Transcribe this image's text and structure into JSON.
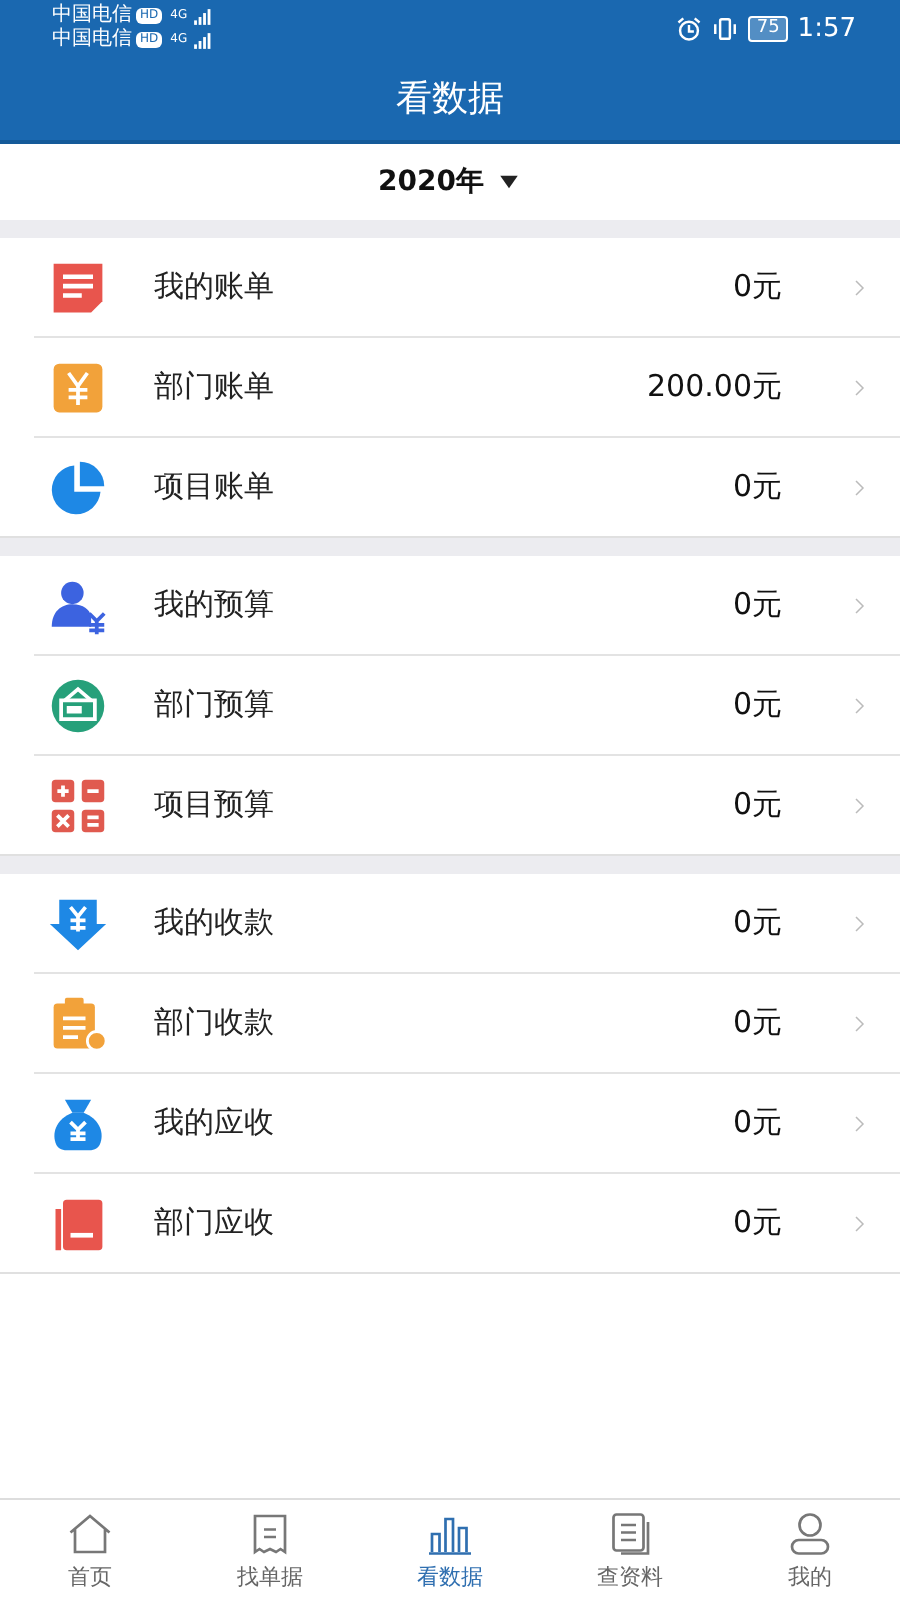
{
  "status_bar": {
    "carriers": [
      {
        "name": "中国电信",
        "badge": "HD",
        "network": "4G"
      },
      {
        "name": "中国电信",
        "badge": "HD",
        "network": "4G"
      }
    ],
    "battery": "75",
    "time": "1:57"
  },
  "title": "看数据",
  "year_picker": {
    "label": "2020年"
  },
  "groups": [
    {
      "items": [
        {
          "kind": "my-bill",
          "label": "我的账单",
          "amount": "0元"
        },
        {
          "kind": "dept-bill",
          "label": "部门账单",
          "amount": "200.00元"
        },
        {
          "kind": "project-bill",
          "label": "项目账单",
          "amount": "0元"
        }
      ]
    },
    {
      "items": [
        {
          "kind": "my-budget",
          "label": "我的预算",
          "amount": "0元"
        },
        {
          "kind": "dept-budget",
          "label": "部门预算",
          "amount": "0元"
        },
        {
          "kind": "project-budget",
          "label": "项目预算",
          "amount": "0元"
        }
      ]
    },
    {
      "items": [
        {
          "kind": "my-receipt",
          "label": "我的收款",
          "amount": "0元"
        },
        {
          "kind": "dept-receipt",
          "label": "部门收款",
          "amount": "0元"
        },
        {
          "kind": "my-receivable",
          "label": "我的应收",
          "amount": "0元"
        },
        {
          "kind": "dept-receivable",
          "label": "部门应收",
          "amount": "0元"
        }
      ]
    }
  ],
  "tab_bar": [
    {
      "kind": "home",
      "label": "首页",
      "selected": false
    },
    {
      "kind": "find",
      "label": "找单据",
      "selected": false
    },
    {
      "kind": "stats",
      "label": "看数据",
      "selected": true
    },
    {
      "kind": "docs",
      "label": "查资料",
      "selected": false
    },
    {
      "kind": "me",
      "label": "我的",
      "selected": false
    }
  ]
}
